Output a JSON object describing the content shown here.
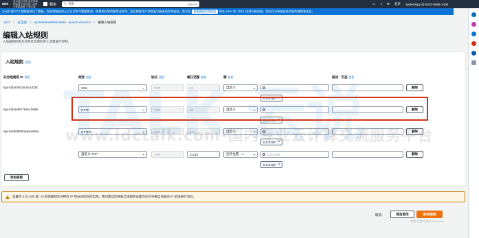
{
  "topbar": {
    "logo": "aws",
    "brand": "亚马逊云科技 由光环新网运营 北京区域 / 由西云数据运营 宁夏区域",
    "services_label": "服务",
    "search_placeholder": "搜索",
    "search_hotkey": "[Alt+S]",
    "region": "北京",
    "account": "spiderdopy @ 6232-5666-1408"
  },
  "notice": {
    "text": "主动开通 EC2 控制台进行了更新。您在控制台的上方方式并不需要更改。如果您在您的使用过程中。某位超级用户交提者可能出现异常或持。您可在",
    "link": "查看最新的控制台",
    "tail": "将在 June 25, 2024. 仍然以新资源。您也可以将来自任何图片使得该项目。"
  },
  "breadcrumb": {
    "ec2": "EC2",
    "sg": "安全组",
    "sgid": "sg-05eb5a98b694a965 - launch-wizard-3",
    "current": "编辑入站规则"
  },
  "page": {
    "title": "编辑入站规则",
    "subtitle": "入站规则控制允许到达实例的传入流量进行控制。"
  },
  "panel": {
    "title": "入站规则",
    "info": "信息",
    "headers": {
      "rule_id": "安全组规则 ID",
      "type": "类型",
      "protocol": "协议",
      "port": "端口范围",
      "source": "源",
      "description": "描述 - 可选"
    },
    "rows": [
      {
        "id": "sgr-02b449015c5ca33fd",
        "type": "SSH",
        "protocol": "TCP",
        "port": "22",
        "source": "自定义",
        "cidr": "0.0.0.0/0",
        "delete": "删除"
      },
      {
        "id": "sgr-03b4e6f2791e1b588",
        "type": "HTTP",
        "protocol": "TCP",
        "port": "80",
        "source": "自定义",
        "cidr": "0.0.0.0/0",
        "delete": "删除"
      },
      {
        "id": "sgr-0e0bd9054a9a1606a",
        "type": "HTTPS",
        "protocol": "TCP",
        "port": "443",
        "source": "自定义",
        "cidr": "0.0.0.0/0",
        "delete": "删除"
      },
      {
        "id": "-",
        "type": "自定义 TCP",
        "protocol": "TCP",
        "port": "21114",
        "source": "任何位置 - I...",
        "cidr": "0.0.0.0/0",
        "source_search": "0.0.0.0/0",
        "delete": "删除"
      }
    ],
    "add_rule": "添加规则"
  },
  "warning": {
    "text": "设置为 0.0.0.0/0 或 ::/0 的源规则允许所有 IP 地址访问您的实例。我们建议您将安全组规则设置为仅允许来自已知的 IP 地址进行访问。"
  },
  "footer": {
    "cancel": "取消",
    "preview": "预览更改",
    "save": "保存规则",
    "watermark": "转到“设置”以激活 Windows。"
  },
  "overlay": {
    "logo": "TALK 云说",
    "url": "www.idctalk.com-国内专业云计算交流服务平台"
  }
}
